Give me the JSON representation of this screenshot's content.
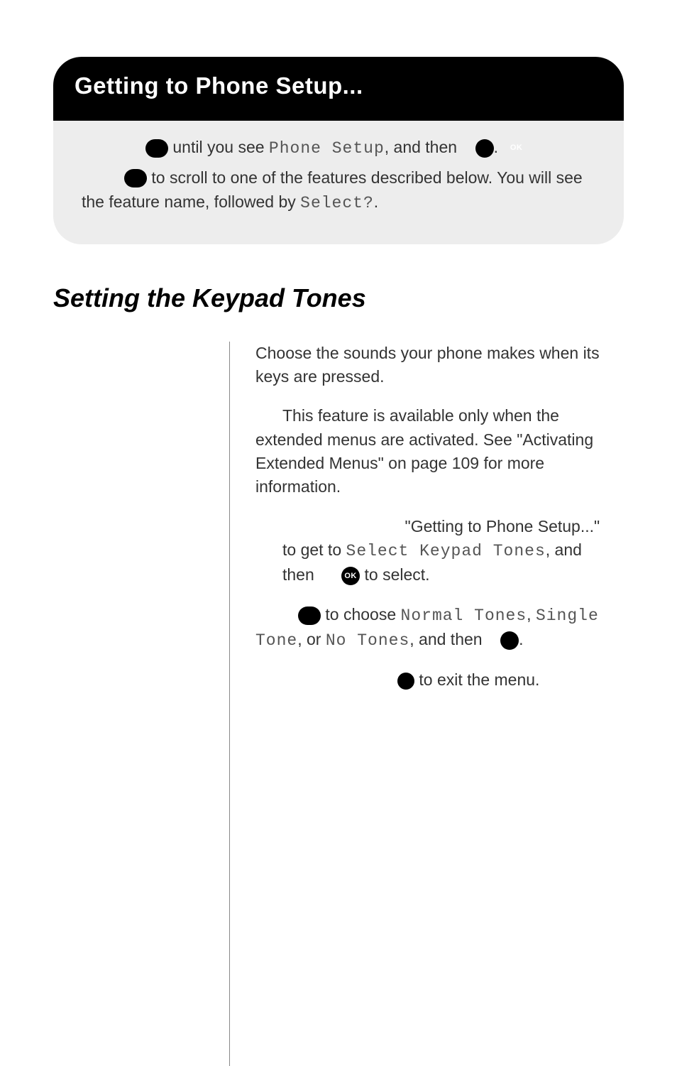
{
  "banner_title": "Getting to Phone Setup...",
  "box": {
    "line1_a": " until you see ",
    "line1_lcd": "Phone Setup",
    "line1_b": ", and then ",
    "line1_c": ".",
    "line2_a": " to scroll to one of the features described below. You will see the feature name, followed by ",
    "line2_lcd": "Select?",
    "line2_b": "."
  },
  "section_title": "Setting the Keypad Tones",
  "body": {
    "p1": "Choose the sounds your phone makes when its keys are pressed.",
    "p2": "This feature is available only when the extended menus are activated. See \"Activating Extended Menus\" on page 109 for more information.",
    "step1_a": "\"Getting to Phone Setup...\" to get to ",
    "step1_lcd": "Select Keypad Tones",
    "step1_b": ", and then ",
    "step1_c": " to select.",
    "step2_a": " to choose ",
    "step2_lcd1": "Normal Tones",
    "step2_b": ", ",
    "step2_lcd2": "Single Tone",
    "step2_c": ", or ",
    "step2_lcd3": "No Tones",
    "step2_d": ", and then ",
    "step2_e": ".",
    "step3_a": " to exit the menu."
  },
  "icons": {
    "menu": "MENU",
    "ok": "OK",
    "c": "C"
  }
}
